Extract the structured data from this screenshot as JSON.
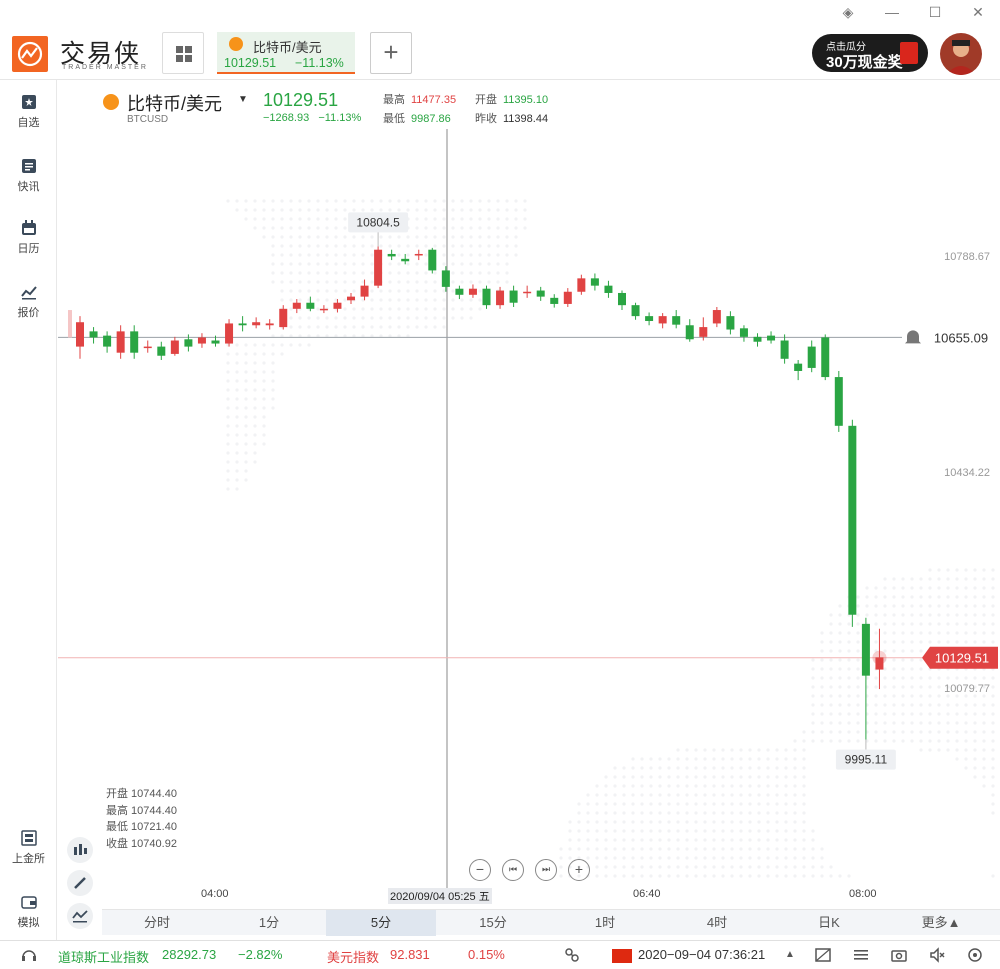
{
  "app": {
    "logo_text": "交易侠",
    "logo_sub": "TRADER MASTER",
    "promo_line1": "点击瓜分",
    "promo_line2": "30万现金奖",
    "win_controls": [
      "◈",
      "—",
      "☐",
      "✕"
    ]
  },
  "tab": {
    "name": "比特币/美元",
    "price": "10129.51",
    "change_pct": "−11.13%",
    "add_label": "+"
  },
  "sidebar": [
    {
      "label": "自选",
      "icon": "bookmark-icon"
    },
    {
      "label": "快讯",
      "icon": "news-icon"
    },
    {
      "label": "日历",
      "icon": "calendar-icon"
    },
    {
      "label": "报价",
      "icon": "trend-icon"
    },
    {
      "label": "上金所",
      "icon": "exchange-icon"
    },
    {
      "label": "模拟",
      "icon": "wallet-icon"
    }
  ],
  "quote": {
    "name": "比特币/美元",
    "caret": "▼",
    "symbol": "BTCUSD",
    "price": "10129.51",
    "change": "−1268.93",
    "change_pct": "−11.13%",
    "high_label": "最高",
    "high": "11477.35",
    "open_label": "开盘",
    "open": "11395.10",
    "low_label": "最低",
    "low": "9987.86",
    "prev_label": "昨收",
    "prev": "11398.44"
  },
  "ohlc_info": {
    "open": "开盘 10744.40",
    "high": "最高 10744.40",
    "low": "最低 10721.40",
    "close": "收盘 10740.92"
  },
  "x_axis": {
    "t1": "04:00",
    "center": "2020/09/04 05:25 五",
    "t2": "06:40",
    "t3": "08:00"
  },
  "timeframes": [
    "分时",
    "1分",
    "5分",
    "15分",
    "1时",
    "4时",
    "日K",
    "更多▲"
  ],
  "active_timeframe": 2,
  "zoom": [
    "−",
    "⏮",
    "⏭",
    "+"
  ],
  "status": {
    "dow_name": "道琼斯工业指数",
    "dow_value": "28292.73",
    "dow_pct": "−2.82%",
    "usd_name": "美元指数",
    "usd_value": "92.831",
    "usd_pct": "0.15%",
    "datetime": "2020−09−04 07:36:21",
    "caret": "▲"
  },
  "colors": {
    "up": "#e04343",
    "down": "#2aa543",
    "accent": "#f26522",
    "bitcoin": "#f7931a"
  },
  "chart_data": {
    "type": "candlestick",
    "y_ticks": [
      "10788.67",
      "10434.22",
      "10079.77"
    ],
    "y_tick_values": [
      10788.67,
      10434.22,
      10079.77
    ],
    "alert_line": {
      "label": "10655.09",
      "value": 10655.09
    },
    "price_line": {
      "label": "10129.51",
      "value": 10129.51
    },
    "max_marker": {
      "label": "10804.5",
      "value": 10804.5
    },
    "min_marker": {
      "label": "9995.11",
      "value": 9995.11
    },
    "candles": [
      [
        10640,
        10680,
        10690,
        10620
      ],
      [
        10665,
        10655,
        10672,
        10645
      ],
      [
        10658,
        10640,
        10665,
        10630
      ],
      [
        10630,
        10665,
        10675,
        10620
      ],
      [
        10665,
        10630,
        10675,
        10620
      ],
      [
        10638,
        10640,
        10650,
        10630
      ],
      [
        10640,
        10625,
        10648,
        10618
      ],
      [
        10628,
        10650,
        10656,
        10625
      ],
      [
        10652,
        10640,
        10660,
        10632
      ],
      [
        10645,
        10655,
        10662,
        10638
      ],
      [
        10650,
        10645,
        10658,
        10640
      ],
      [
        10645,
        10678,
        10685,
        10640
      ],
      [
        10678,
        10675,
        10690,
        10665
      ],
      [
        10675,
        10680,
        10688,
        10670
      ],
      [
        10675,
        10678,
        10685,
        10668
      ],
      [
        10672,
        10702,
        10708,
        10668
      ],
      [
        10702,
        10712,
        10718,
        10695
      ],
      [
        10712,
        10702,
        10722,
        10698
      ],
      [
        10702,
        10702,
        10708,
        10695
      ],
      [
        10702,
        10712,
        10718,
        10696
      ],
      [
        10716,
        10722,
        10728,
        10710
      ],
      [
        10722,
        10740,
        10750,
        10716
      ],
      [
        10740,
        10799,
        10804.5,
        10736
      ],
      [
        10792,
        10788,
        10799,
        10782
      ],
      [
        10784,
        10780,
        10792,
        10775
      ],
      [
        10790,
        10792,
        10799,
        10782
      ],
      [
        10799,
        10765,
        10802,
        10760
      ],
      [
        10765,
        10738,
        10772,
        10730
      ],
      [
        10735,
        10725,
        10740,
        10718
      ],
      [
        10725,
        10735,
        10742,
        10720
      ],
      [
        10735,
        10708,
        10740,
        10702
      ],
      [
        10708,
        10732,
        10738,
        10702
      ],
      [
        10732,
        10712,
        10740,
        10705
      ],
      [
        10728,
        10730,
        10740,
        10720
      ],
      [
        10732,
        10722,
        10738,
        10715
      ],
      [
        10720,
        10710,
        10726,
        10704
      ],
      [
        10710,
        10730,
        10736,
        10705
      ],
      [
        10730,
        10752,
        10758,
        10725
      ],
      [
        10752,
        10740,
        10760,
        10732
      ],
      [
        10740,
        10728,
        10748,
        10720
      ],
      [
        10728,
        10708,
        10732,
        10700
      ],
      [
        10708,
        10690,
        10712,
        10684
      ],
      [
        10690,
        10682,
        10696,
        10675
      ],
      [
        10678,
        10690,
        10695,
        10670
      ],
      [
        10690,
        10676,
        10700,
        10670
      ],
      [
        10675,
        10652,
        10685,
        10648
      ],
      [
        10656,
        10672,
        10688,
        10650
      ],
      [
        10678,
        10700,
        10705,
        10672
      ],
      [
        10690,
        10668,
        10698,
        10660
      ],
      [
        10670,
        10656,
        10675,
        10648
      ],
      [
        10656,
        10648,
        10662,
        10640
      ],
      [
        10658,
        10650,
        10665,
        10645
      ],
      [
        10650,
        10620,
        10660,
        10612
      ],
      [
        10612,
        10600,
        10618,
        10585
      ],
      [
        10640,
        10605,
        10650,
        10598
      ],
      [
        10655,
        10590,
        10660,
        10585
      ],
      [
        10590,
        10510,
        10600,
        10500
      ],
      [
        10510,
        10200,
        10520,
        10180
      ],
      [
        10185,
        10100,
        10195,
        9995.11
      ],
      [
        10110,
        10130,
        10177,
        10078
      ]
    ]
  }
}
